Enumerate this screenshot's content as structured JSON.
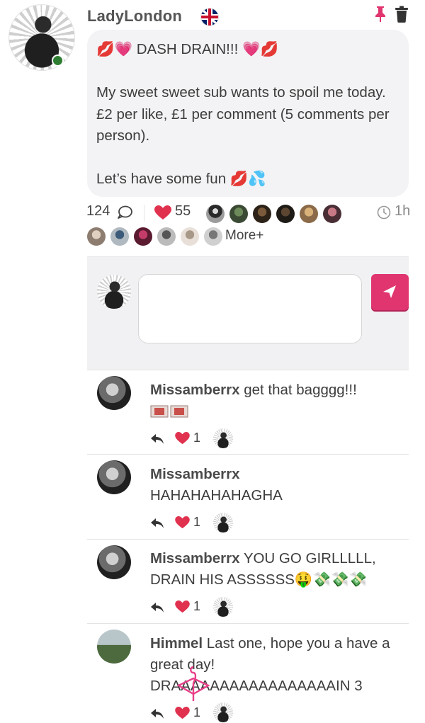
{
  "post": {
    "author": "LadyLondon",
    "text": "💋💗 DASH DRAIN!!! 💗💋\n\nMy sweet sweet sub wants to spoil me today. £2 per like, £1 per comment (5 comments per person).\n\nLet’s have some fun 💋💦",
    "comment_count": "124",
    "like_count": "55",
    "time": "1h",
    "more_label": "More+"
  },
  "colors": {
    "accent": "#e0356f",
    "heart": "#e0324f",
    "online": "#2e7d32"
  },
  "icons": [
    "uk-flag-icon",
    "pin-icon",
    "trash-icon",
    "comment-bubble-icon",
    "heart-icon",
    "clock-icon",
    "send-icon",
    "reply-icon"
  ],
  "comments": [
    {
      "author": "Missamberrx",
      "text": "get that bagggg!!!",
      "likes": "1"
    },
    {
      "author": "Missamberrx",
      "text": "HAHAHAHAHAGHA",
      "likes": "1"
    },
    {
      "author": "Missamberrx",
      "text": "YOU GO GIRLLLLL, DRAIN HIS ASSSSSS🤑💸💸💸",
      "likes": "1"
    },
    {
      "author": "Himmel",
      "text": "Last one, hope you a have a great day! DRAAAAAAAAAAAAAAAAAIN 3",
      "likes": "1"
    }
  ]
}
